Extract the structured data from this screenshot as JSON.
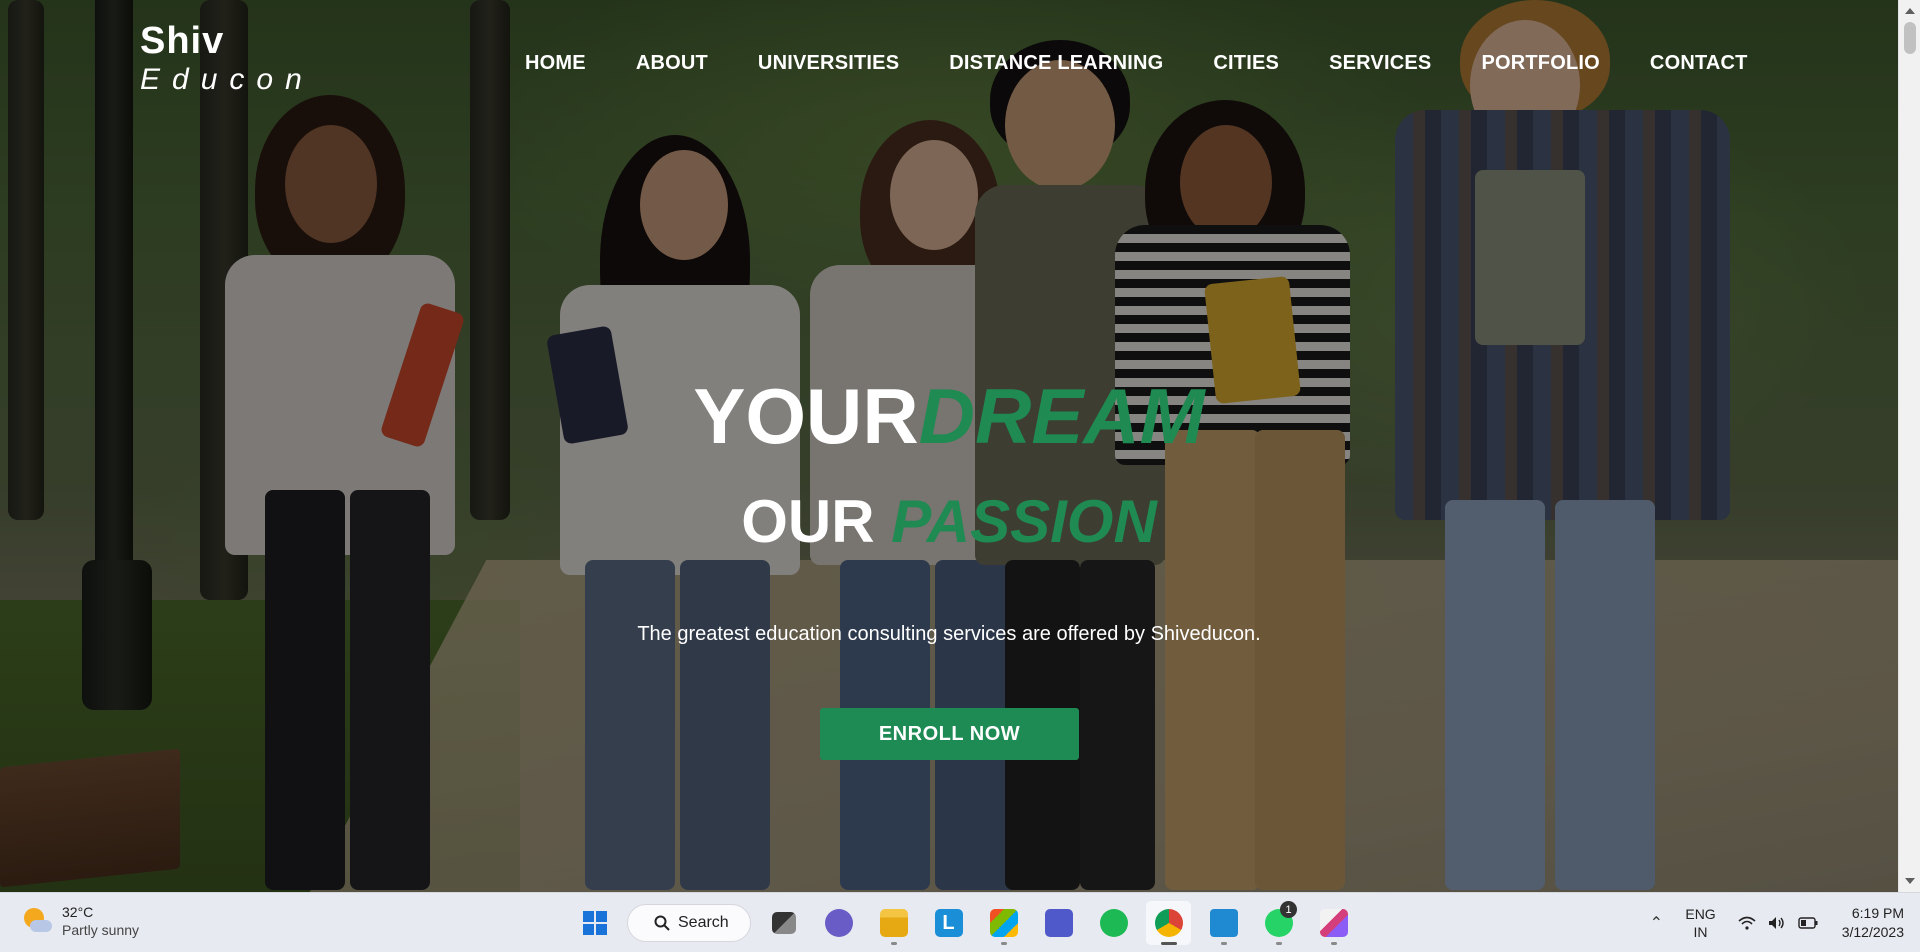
{
  "brand": {
    "name_main": "Shiv",
    "name_sub": "Educon"
  },
  "nav": {
    "items": [
      {
        "label": "HOME"
      },
      {
        "label": "ABOUT"
      },
      {
        "label": "UNIVERSITIES"
      },
      {
        "label": "DISTANCE LEARNING"
      },
      {
        "label": "CITIES"
      },
      {
        "label": "SERVICES"
      },
      {
        "label": "PORTFOLIO"
      },
      {
        "label": "CONTACT"
      }
    ]
  },
  "hero": {
    "line1_plain": "YOUR",
    "line1_accent": "DREAM",
    "line2_plain": "OUR ",
    "line2_accent": "PASSION",
    "tagline": "The greatest education consulting services are offered by Shiveducon.",
    "cta_label": "ENROLL NOW"
  },
  "colors": {
    "accent": "#1e8a54",
    "nav_text": "#ffffff"
  },
  "taskbar": {
    "weather": {
      "temp": "32°C",
      "condition": "Partly sunny"
    },
    "search_label": "Search",
    "apps": [
      {
        "name": "start-icon"
      },
      {
        "name": "task-view-icon"
      },
      {
        "name": "chat-icon"
      },
      {
        "name": "file-explorer-icon"
      },
      {
        "name": "l-app-icon"
      },
      {
        "name": "store-icon"
      },
      {
        "name": "teams-icon"
      },
      {
        "name": "spotify-icon"
      },
      {
        "name": "chrome-icon"
      },
      {
        "name": "vscode-icon"
      },
      {
        "name": "whatsapp-icon",
        "badge": "1"
      },
      {
        "name": "snipping-tool-icon"
      }
    ],
    "language": {
      "line1": "ENG",
      "line2": "IN"
    },
    "clock": {
      "time": "6:19 PM",
      "date": "3/12/2023"
    }
  }
}
